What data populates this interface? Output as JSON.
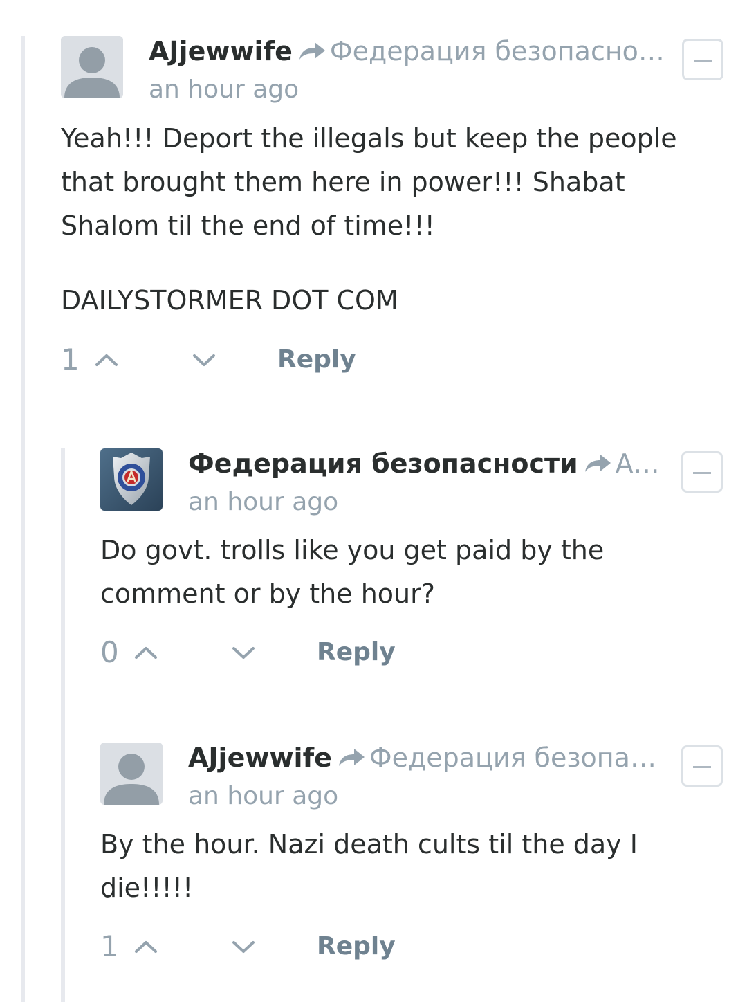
{
  "comments": [
    {
      "author": "AJjewwife",
      "reply_to": "Федерация безопасно…",
      "time": "an hour ago",
      "avatar": "default-avatar",
      "paragraphs": [
        "Yeah!!! Deport the illegals but keep the people that brought them here in power!!! Shabat Shalom til the end of time!!!",
        "DAILYSTORMER DOT COM"
      ],
      "votes": "1",
      "reply_label": "Reply"
    },
    {
      "author": "Федерация безопасности",
      "reply_to": "A…",
      "time": "an hour ago",
      "avatar": "badge-avatar",
      "paragraphs": [
        "Do govt. trolls like you get paid by the comment or by the hour?"
      ],
      "votes": "0",
      "reply_label": "Reply"
    },
    {
      "author": "AJjewwife",
      "reply_to": "Федерация безопа…",
      "time": "an hour ago",
      "avatar": "default-avatar",
      "paragraphs": [
        "By the hour. Nazi death cults til the day I die!!!!!"
      ],
      "votes": "1",
      "reply_label": "Reply"
    }
  ],
  "icons": {
    "reply_arrow": "share-arrow-icon",
    "upvote": "chevron-up-icon",
    "downvote": "chevron-down-icon",
    "collapse": "minus-icon"
  },
  "colors": {
    "text": "#2a2e2e",
    "muted": "#95a3ae",
    "reply_link": "#6f8290",
    "thread_line": "#e7e9ee"
  }
}
